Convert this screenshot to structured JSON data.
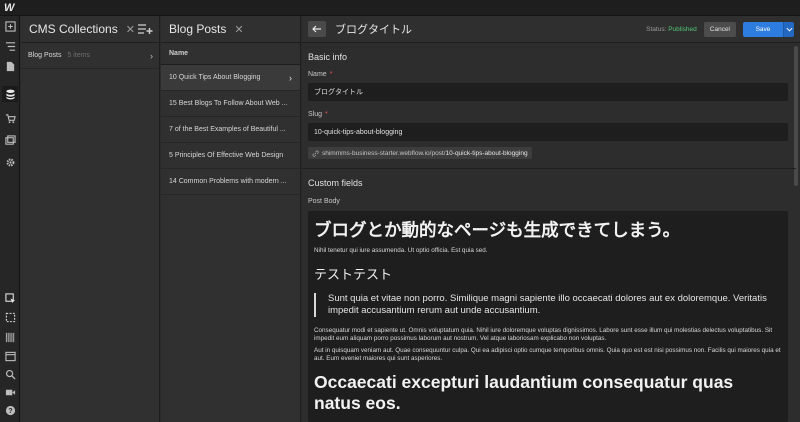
{
  "app": {
    "logo": "W"
  },
  "collections": {
    "title": "CMS Collections",
    "close": "✕",
    "items": [
      {
        "label": "Blog Posts",
        "count": "5 items"
      }
    ]
  },
  "posts": {
    "title": "Blog Posts",
    "close": "✕",
    "column_header": "Name",
    "rows": [
      "10 Quick Tips About Blogging",
      "15 Best Blogs To Follow About Web ...",
      "7 of the Best Examples of Beautiful ...",
      "5 Principles Of Effective Web Design",
      "14 Common Problems with modern ..."
    ]
  },
  "editor": {
    "title": "ブログタイトル",
    "status_label": "Status:",
    "status_value": "Published",
    "cancel_label": "Cancel",
    "save_label": "Save",
    "basic_info_title": "Basic info",
    "name_label": "Name",
    "name_value": "ブログタイトル",
    "slug_label": "Slug",
    "slug_value": "10-quick-tips-about-blogging",
    "url_prefix": "shimmms-business-starter.webflow.io/post/",
    "url_slug": "10-quick-tips-about-blogging",
    "custom_fields_title": "Custom fields",
    "post_body_label": "Post Body",
    "required_mark": "*"
  },
  "body": {
    "h1": "ブログとか動的なページも生成できてしまう。",
    "p1": "Nihil tenetur qui iure assumenda. Ut optio officia. Est quia sed.",
    "h2": "テストテスト",
    "quote": "Sunt quia et vitae non porro. Similique magni sapiente illo occaecati dolores aut ex doloremque. Veritatis impedit accusantium rerum aut unde accusantium.",
    "p2": "Consequatur modi et sapiente ut. Omnis voluptatum quia. Nihil iure doloremque voluptas dignissimos. Labore sunt esse illum qui molestias delectus voluptatibus. Sit impedit eum aliquam porro possimus laborum aut nostrum. Vel atque laboriosam explicabo non voluptas.",
    "p3": "Aut in quisquam veniam aut. Quae consequuntur culpa. Qui ea adipisci optio cumque temporibus omnis. Quia quo est est nisi possimus non. Facilis qui maiores quia et aut. Eum eveniet maiores qui sunt asperiores.",
    "h1b": "Occaecati excepturi laudantium consequatur quas natus eos."
  },
  "colors": {
    "published": "#52c776",
    "save": "#2d7de0",
    "required": "#e0554e"
  }
}
